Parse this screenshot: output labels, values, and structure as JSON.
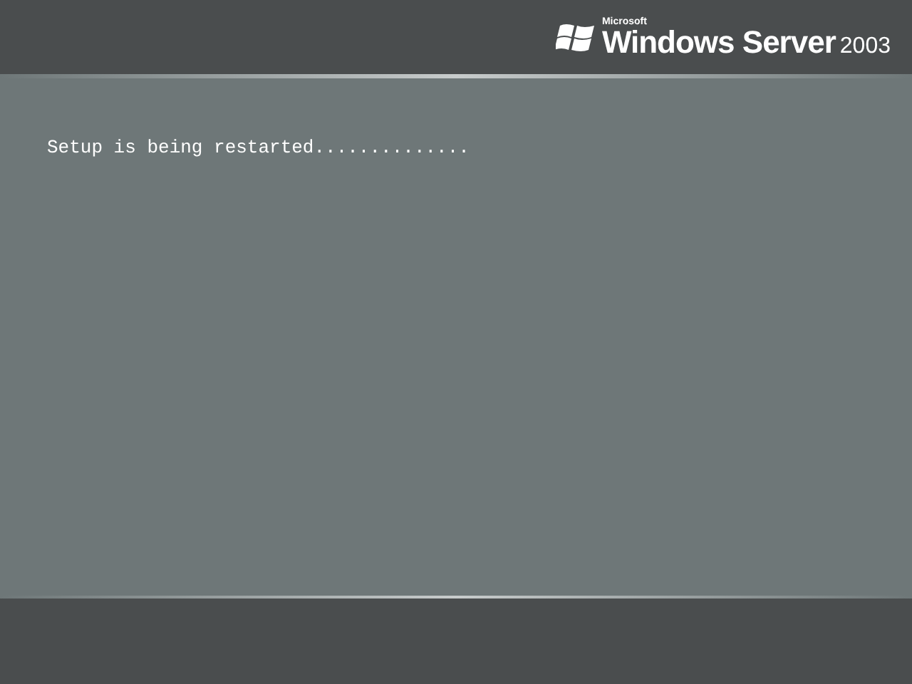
{
  "logo": {
    "company": "Microsoft",
    "product": "Windows Server",
    "version": "2003"
  },
  "message": "Setup is being restarted.............."
}
